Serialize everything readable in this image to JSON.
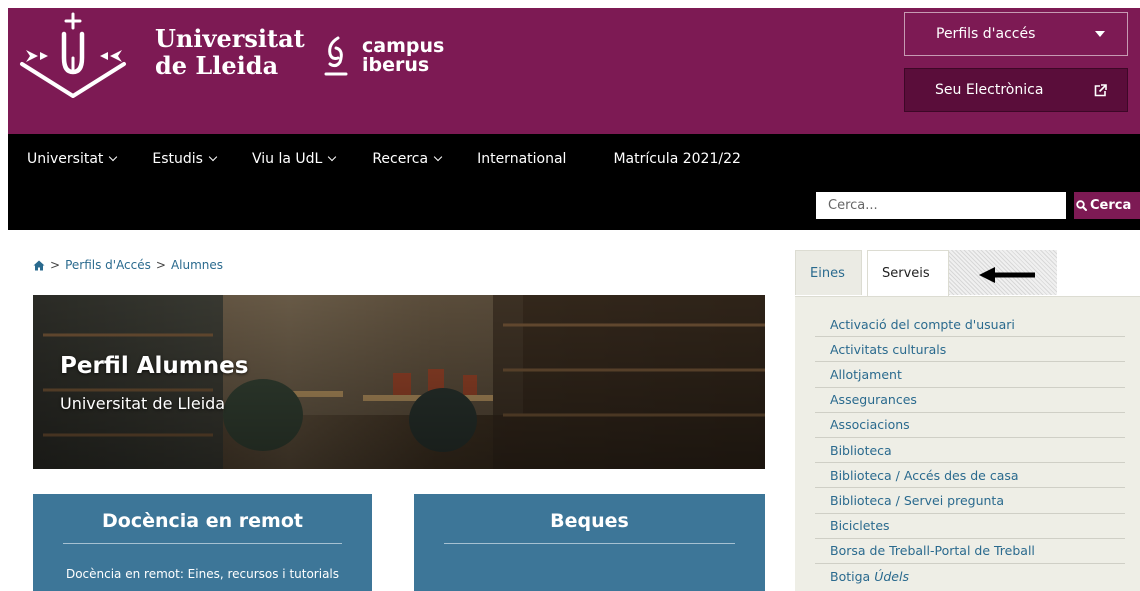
{
  "header": {
    "university_name_line1": "Universitat",
    "university_name_line2": "de Lleida",
    "campus_line1": "campus",
    "campus_line2": "iberus",
    "profiles_label": "Perfils d'accés",
    "seu_label": "Seu Electrònica",
    "brand_color": "#7d1a54"
  },
  "nav": {
    "items": [
      {
        "label": "Universitat",
        "dropdown": true
      },
      {
        "label": "Estudis",
        "dropdown": true
      },
      {
        "label": "Viu la UdL",
        "dropdown": true
      },
      {
        "label": "Recerca",
        "dropdown": true
      },
      {
        "label": "International",
        "dropdown": false
      },
      {
        "label": "Matrícula 2021/22",
        "dropdown": false
      }
    ],
    "search_placeholder": "Cerca...",
    "search_button": "Cerca"
  },
  "breadcrumb": {
    "separator": ">",
    "items": [
      "Perfils d'Accés",
      "Alumnes"
    ]
  },
  "hero": {
    "title": "Perfil Alumnes",
    "subtitle": "Universitat de Lleida"
  },
  "cards": [
    {
      "title": "Docència en remot",
      "text": "Docència en remot: Eines, recursos i tutorials"
    },
    {
      "title": "Beques",
      "text": ""
    }
  ],
  "sidebar": {
    "tabs": [
      {
        "label": "Eines",
        "active": false
      },
      {
        "label": "Serveis",
        "active": true
      }
    ],
    "services": [
      {
        "label": "Activació del compte d'usuari"
      },
      {
        "label": "Activitats culturals"
      },
      {
        "label": "Allotjament"
      },
      {
        "label": "Assegurances"
      },
      {
        "label": "Associacions"
      },
      {
        "label": "Biblioteca"
      },
      {
        "label": "Biblioteca / Accés des de casa"
      },
      {
        "label": "Biblioteca / Servei pregunta"
      },
      {
        "label": "Bicicletes"
      },
      {
        "label": "Borsa de Treball-Portal de Treball"
      },
      {
        "label": "Botiga",
        "italic_suffix": "Údels"
      }
    ]
  }
}
